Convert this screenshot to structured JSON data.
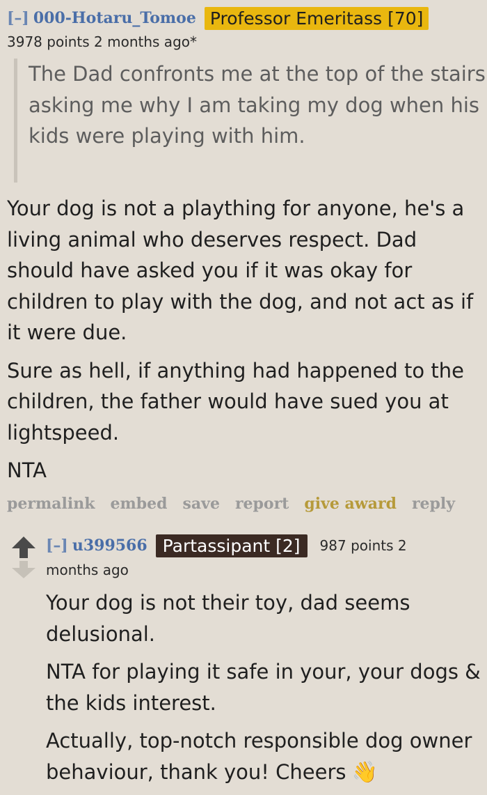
{
  "comment1": {
    "collapse": "[–]",
    "author": "000-Hotaru_Tomoe",
    "flair": "Professor Emeritass [70]",
    "meta": "3978 points 2 months ago*",
    "quote": "The Dad confronts me at the top of the stairs asking me why I am taking my dog when his kids were playing with him.",
    "paragraphs": [
      "Your dog is not a plaything for anyone, he's a living animal who deserves respect. Dad should have asked you if it was okay for children to play with the dog, and not act as if it were due.",
      "Sure as hell, if anything had happened to the children, the father would have sued you at lightspeed.",
      "NTA"
    ],
    "actions": {
      "permalink": "permalink",
      "embed": "embed",
      "save": "save",
      "report": "report",
      "give_award": "give award",
      "reply": "reply"
    }
  },
  "comment2": {
    "collapse": "[–]",
    "author": "u399566",
    "flair": "Partassipant [2]",
    "points": "987 points 2",
    "meta": "months ago",
    "paragraphs": [
      "Your dog is not their toy, dad seems delusional.",
      "NTA for playing it safe in your, your dogs & the kids interest.",
      "Actually, top-notch responsible dog owner behaviour, thank you! Cheers"
    ],
    "emoji": "👋",
    "icons": {
      "upvote": "upvote-arrow-icon",
      "downvote": "downvote-arrow-icon"
    }
  },
  "colors": {
    "background": "#e3ddd4",
    "author_link": "#4a6ea8",
    "flair_gold": "#e9b70f",
    "flair_dark": "#3b2a23",
    "award": "#b69a3a"
  }
}
